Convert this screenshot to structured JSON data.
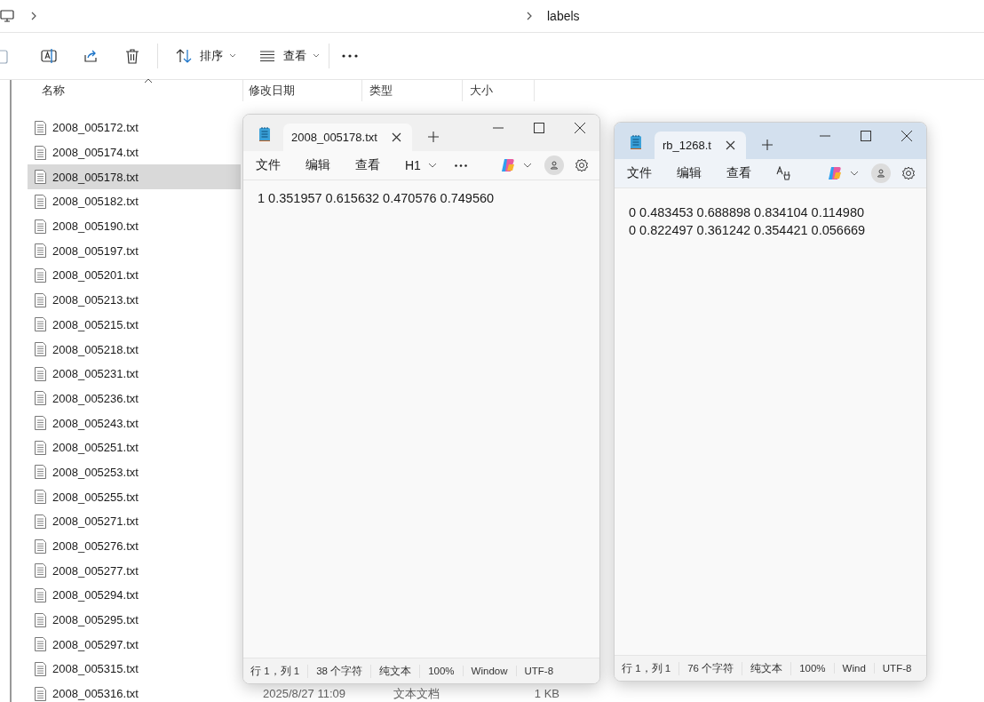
{
  "explorer": {
    "breadcrumb": {
      "current": "labels"
    },
    "toolbar": [
      {
        "kind": "copy"
      },
      {
        "kind": "rename"
      },
      {
        "kind": "share"
      },
      {
        "kind": "delete"
      },
      {
        "kind": "sort",
        "label": "排序"
      },
      {
        "kind": "view",
        "label": "查看"
      },
      {
        "kind": "more"
      }
    ],
    "columns": [
      "名称",
      "修改日期",
      "类型",
      "大小"
    ],
    "files": [
      {
        "name": "2008_005172.txt",
        "selected": false
      },
      {
        "name": "2008_005174.txt",
        "selected": false
      },
      {
        "name": "2008_005178.txt",
        "selected": true
      },
      {
        "name": "2008_005182.txt",
        "selected": false
      },
      {
        "name": "2008_005190.txt",
        "selected": false
      },
      {
        "name": "2008_005197.txt",
        "selected": false
      },
      {
        "name": "2008_005201.txt",
        "selected": false
      },
      {
        "name": "2008_005213.txt",
        "selected": false
      },
      {
        "name": "2008_005215.txt",
        "selected": false
      },
      {
        "name": "2008_005218.txt",
        "selected": false
      },
      {
        "name": "2008_005231.txt",
        "selected": false
      },
      {
        "name": "2008_005236.txt",
        "selected": false
      },
      {
        "name": "2008_005243.txt",
        "selected": false
      },
      {
        "name": "2008_005251.txt",
        "selected": false
      },
      {
        "name": "2008_005253.txt",
        "selected": false
      },
      {
        "name": "2008_005255.txt",
        "selected": false
      },
      {
        "name": "2008_005271.txt",
        "selected": false
      },
      {
        "name": "2008_005276.txt",
        "selected": false
      },
      {
        "name": "2008_005277.txt",
        "selected": false
      },
      {
        "name": "2008_005294.txt",
        "selected": false
      },
      {
        "name": "2008_005295.txt",
        "selected": false
      },
      {
        "name": "2008_005297.txt",
        "selected": false
      },
      {
        "name": "2008_005315.txt",
        "selected": false
      },
      {
        "name": "2008_005316.txt",
        "selected": false,
        "modified": "2025/8/27 11:09",
        "type": "文本文档",
        "size": "1 KB"
      }
    ]
  },
  "notepads": [
    {
      "tab": "2008_005178.txt",
      "active": false,
      "menu": [
        "文件",
        "编辑",
        "查看"
      ],
      "heading": "H1",
      "lines": [
        "1 0.351957 0.615632 0.470576 0.749560"
      ],
      "status": [
        "行 1，列 1",
        "38 个字符",
        "纯文本",
        "100%",
        "Window",
        "UTF-8"
      ]
    },
    {
      "tab": "rb_1268.t",
      "active": true,
      "menu": [
        "文件",
        "编辑",
        "查看"
      ],
      "lines": [
        "0 0.483453 0.688898 0.834104 0.114980",
        "0 0.822497 0.361242 0.354421 0.056669"
      ],
      "status": [
        "行 1，列 1",
        "76 个字符",
        "纯文本",
        "100%",
        "Wind",
        "UTF-8"
      ]
    }
  ]
}
